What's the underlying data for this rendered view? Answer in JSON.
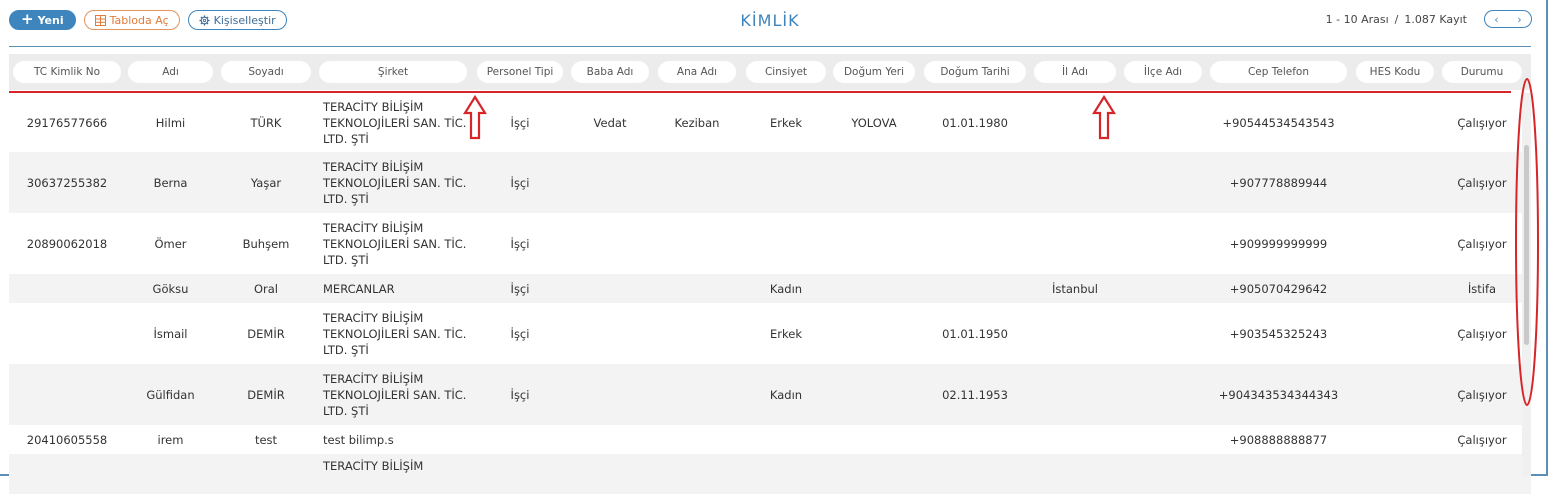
{
  "toolbar": {
    "new_label": "Yeni",
    "table_label": "Tabloda Aç",
    "customize_label": "Kişiselleştir"
  },
  "title": "KİMLİK",
  "pager": {
    "range": "1 - 10 Arası",
    "separator": "/",
    "total": "1.087 Kayıt",
    "prev": "‹",
    "next": "›"
  },
  "columns": [
    "TC Kimlik No",
    "Adı",
    "Soyadı",
    "Şirket",
    "Personel Tipi",
    "Baba Adı",
    "Ana Adı",
    "Cinsiyet",
    "Doğum Yeri",
    "Doğum Tarihi",
    "İl Adı",
    "İlçe Adı",
    "Cep Telefon",
    "HES Kodu",
    "Durumu"
  ],
  "rows": [
    {
      "tc": "29176577666",
      "ad": "Hilmi",
      "soyad": "TÜRK",
      "sirket": "TERACİTY BİLİŞİM TEKNOLOJİLERİ SAN. TİC. LTD. ŞTİ",
      "tip": "İşçi",
      "baba": "Vedat",
      "ana": "Keziban",
      "cinsiyet": "Erkek",
      "dyeri": "YOLOVA",
      "dtarih": "01.01.1980",
      "il": "",
      "ilce": "",
      "tel": "+90544534543543",
      "hes": "",
      "durum": "Çalışıyor"
    },
    {
      "tc": "30637255382",
      "ad": "Berna",
      "soyad": "Yaşar",
      "sirket": "TERACİTY BİLİŞİM TEKNOLOJİLERİ SAN. TİC. LTD. ŞTİ",
      "tip": "İşçi",
      "baba": "",
      "ana": "",
      "cinsiyet": "",
      "dyeri": "",
      "dtarih": "",
      "il": "",
      "ilce": "",
      "tel": "+907778889944",
      "hes": "",
      "durum": "Çalışıyor"
    },
    {
      "tc": "20890062018",
      "ad": "Ömer",
      "soyad": "Buhşem",
      "sirket": "TERACİTY BİLİŞİM TEKNOLOJİLERİ SAN. TİC. LTD. ŞTİ",
      "tip": "İşçi",
      "baba": "",
      "ana": "",
      "cinsiyet": "",
      "dyeri": "",
      "dtarih": "",
      "il": "",
      "ilce": "",
      "tel": "+909999999999",
      "hes": "",
      "durum": "Çalışıyor"
    },
    {
      "tc": "",
      "ad": "Göksu",
      "soyad": "Oral",
      "sirket": "MERCANLAR",
      "tip": "İşçi",
      "baba": "",
      "ana": "",
      "cinsiyet": "Kadın",
      "dyeri": "",
      "dtarih": "",
      "il": "İstanbul",
      "ilce": "",
      "tel": "+905070429642",
      "hes": "",
      "durum": "İstifa"
    },
    {
      "tc": "",
      "ad": "İsmail",
      "soyad": "DEMİR",
      "sirket": "TERACİTY BİLİŞİM TEKNOLOJİLERİ SAN. TİC. LTD. ŞTİ",
      "tip": "İşçi",
      "baba": "",
      "ana": "",
      "cinsiyet": "Erkek",
      "dyeri": "",
      "dtarih": "01.01.1950",
      "il": "",
      "ilce": "",
      "tel": "+903545325243",
      "hes": "",
      "durum": "Çalışıyor"
    },
    {
      "tc": "",
      "ad": "Gülfidan",
      "soyad": "DEMİR",
      "sirket": "TERACİTY BİLİŞİM TEKNOLOJİLERİ SAN. TİC. LTD. ŞTİ",
      "tip": "İşçi",
      "baba": "",
      "ana": "",
      "cinsiyet": "Kadın",
      "dyeri": "",
      "dtarih": "02.11.1953",
      "il": "",
      "ilce": "",
      "tel": "+904343534344343",
      "hes": "",
      "durum": "Çalışıyor"
    },
    {
      "tc": "20410605558",
      "ad": "irem",
      "soyad": "test",
      "sirket": "test bilimp.s",
      "tip": "",
      "baba": "",
      "ana": "",
      "cinsiyet": "",
      "dyeri": "",
      "dtarih": "",
      "il": "",
      "ilce": "",
      "tel": "+908888888877",
      "hes": "",
      "durum": "Çalışıyor"
    },
    {
      "tc": "",
      "ad": "",
      "soyad": "",
      "sirket": "TERACİTY BİLİŞİM",
      "tip": "",
      "baba": "",
      "ana": "",
      "cinsiyet": "",
      "dyeri": "",
      "dtarih": "",
      "il": "",
      "ilce": "",
      "tel": "",
      "hes": "",
      "durum": ""
    }
  ],
  "annotation_color": "#d6262a",
  "accent_color": "#3f85bd"
}
